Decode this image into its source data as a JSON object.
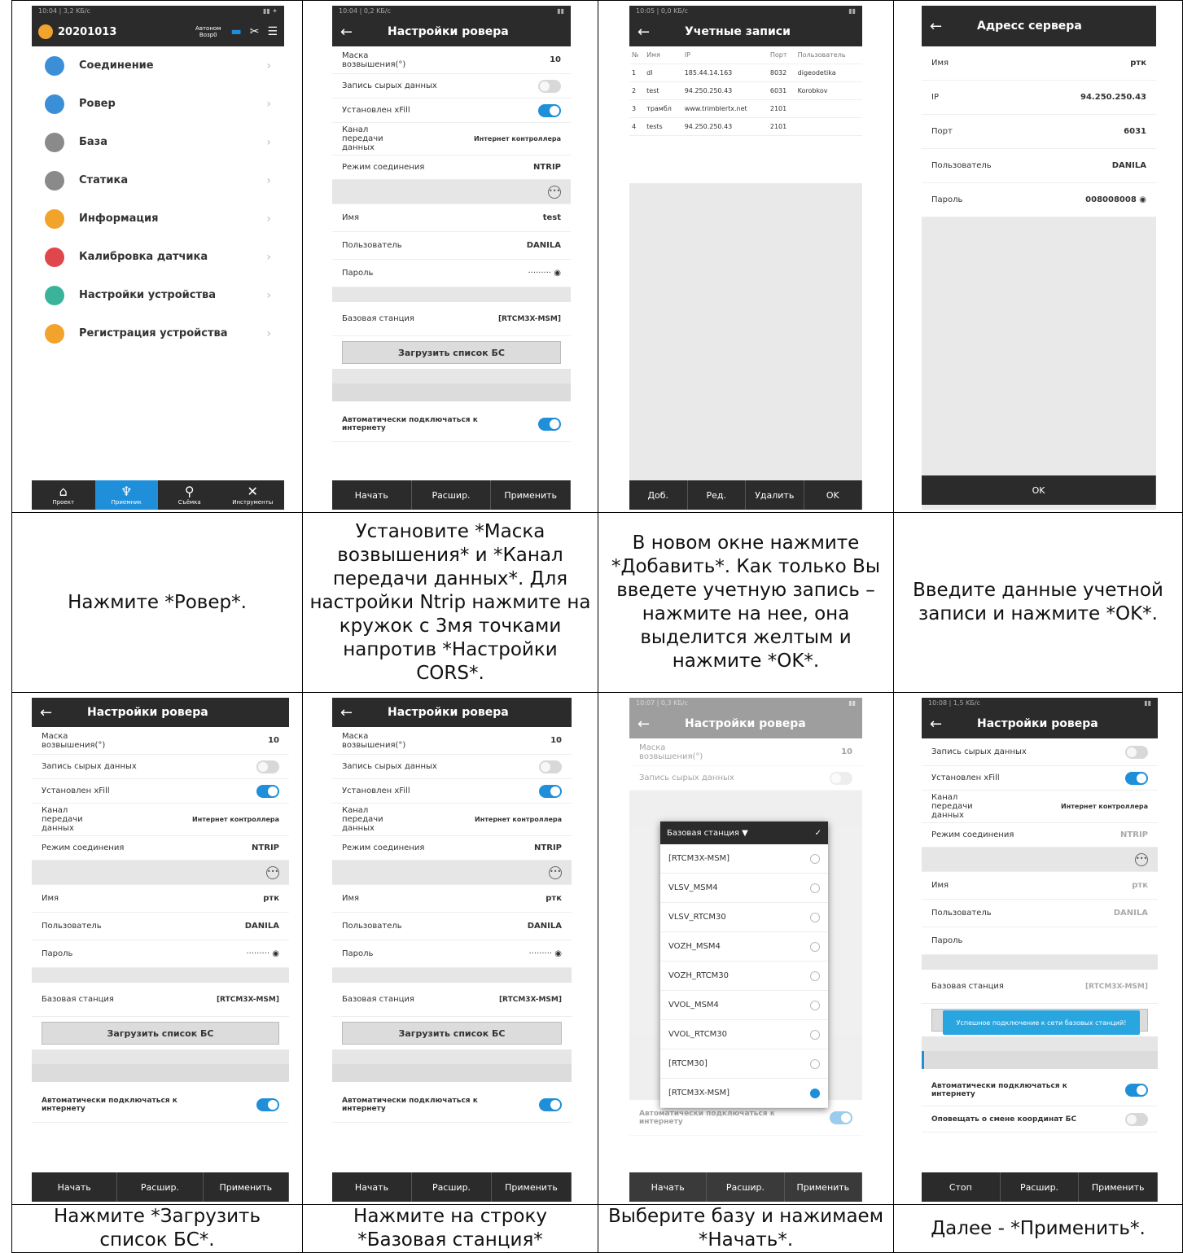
{
  "captions": {
    "c1": "Нажмите *Ровер*.",
    "c2": "Установите *Маска возвышения* и *Канал передачи данных*. Для настройки Ntrip нажмите на кружок с 3мя точками напротив *Настройки CORS*.",
    "c3": "В новом окне нажмите *Добавить*. Как только Вы введете учетную запись – нажмите на нее, она выделится желтым и нажмите *OK*.",
    "c4": "Введите данные учетной записи и нажмите *OK*.",
    "c5": "Нажмите *Загрузить список БС*.",
    "c6": "Нажмите на строку *Базовая станция*",
    "c7": "Выберите базу и нажимаем *Начать*.",
    "c8": "Далее - *Применить*."
  },
  "menu": {
    "project": "20201013",
    "mode": "Автоном",
    "mode2": "Возр0",
    "items": [
      {
        "label": "Соединение",
        "color": "#3a8fd6"
      },
      {
        "label": "Ровер",
        "color": "#3a8fd6"
      },
      {
        "label": "База",
        "color": "#8a8a8a"
      },
      {
        "label": "Статика",
        "color": "#8a8a8a"
      },
      {
        "label": "Информация",
        "color": "#f2a32c"
      },
      {
        "label": "Калибровка датчика",
        "color": "#e0474c"
      },
      {
        "label": "Настройки устройства",
        "color": "#3bb39a"
      },
      {
        "label": "Регистрация устройства",
        "color": "#f2a32c"
      }
    ],
    "tabs": [
      "Проект",
      "Приемник",
      "Съёмка",
      "Инструменты"
    ]
  },
  "rover": {
    "title": "Настройки ровера",
    "mask_label": "Маска возвышения(°)",
    "mask_value": "10",
    "raw_label": "Запись сырых данных",
    "xfill_label": "Установлен xFill",
    "channel_label": "Канал передачи данных",
    "channel_value": "Интернет контроллера",
    "mode_label": "Режим соединения",
    "mode_value": "NTRIP",
    "name_label": "Имя",
    "name_test": "test",
    "name_rtk": "ртк",
    "user_label": "Пользователь",
    "user_value": "DANILA",
    "pass_label": "Пароль",
    "pass_value": "·········",
    "base_label": "Базовая станция",
    "base_value": "[RTCM3X-MSM]",
    "load_button": "Загрузить список БС",
    "auto_label": "Автоматически подключаться к интернету",
    "notify_label": "Оповещать о смене координат БС",
    "btn_start": "Начать",
    "btn_ext": "Расшир.",
    "btn_apply": "Применить",
    "btn_stop": "Стоп"
  },
  "accounts": {
    "title": "Учетные записи",
    "headers": [
      "№",
      "Имя",
      "IP",
      "Порт",
      "Пользователь"
    ],
    "rows": [
      [
        "1",
        "dl",
        "185.44.14.163",
        "8032",
        "digeodetika"
      ],
      [
        "2",
        "test",
        "94.250.250.43",
        "6031",
        "Korobkov"
      ],
      [
        "3",
        "трамбл",
        "www.trimblertx.net",
        "2101",
        ""
      ],
      [
        "4",
        "tests",
        "94.250.250.43",
        "2101",
        ""
      ]
    ],
    "buttons": [
      "Доб.",
      "Ред.",
      "Удалить",
      "OK"
    ]
  },
  "server": {
    "title": "Адресс сервера",
    "rows": [
      {
        "label": "Имя",
        "value": "ртк"
      },
      {
        "label": "IP",
        "value": "94.250.250.43"
      },
      {
        "label": "Порт",
        "value": "6031"
      },
      {
        "label": "Пользователь",
        "value": "DANILA"
      },
      {
        "label": "Пароль",
        "value": "008008008"
      }
    ],
    "ok": "OK"
  },
  "dialog": {
    "title": "Базовая станция",
    "items": [
      "[RTCM3X-MSM]",
      "VLSV_MSM4",
      "VLSV_RTCM30",
      "VOZH_MSM4",
      "VOZH_RTCM30",
      "VVOL_MSM4",
      "VVOL_RTCM30",
      "[RTCM30]",
      "[RTCM3X-MSM]"
    ]
  },
  "toast": "Успешное подключение к сети базовых станций!"
}
